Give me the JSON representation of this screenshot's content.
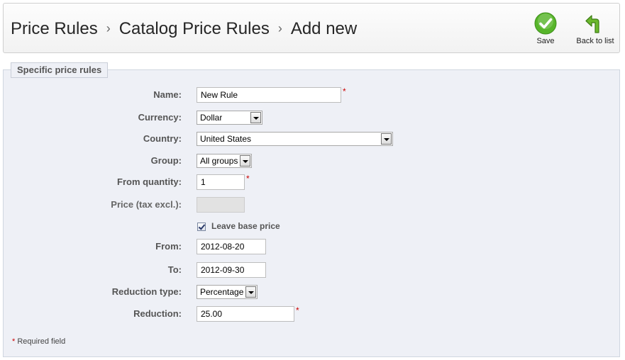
{
  "breadcrumb": [
    "Price Rules",
    "Catalog Price Rules",
    "Add new"
  ],
  "breadcrumb_separator": "›",
  "toolbar": {
    "save_label": "Save",
    "back_label": "Back to list"
  },
  "panel": {
    "legend": "Specific price rules"
  },
  "form": {
    "name": {
      "label": "Name:",
      "value": "New Rule",
      "required": "*"
    },
    "currency": {
      "label": "Currency:",
      "value": "Dollar"
    },
    "country": {
      "label": "Country:",
      "value": "United States"
    },
    "group": {
      "label": "Group:",
      "value": "All groups"
    },
    "from_quantity": {
      "label": "From quantity:",
      "value": "1",
      "required": "*"
    },
    "price": {
      "label": "Price (tax excl.):",
      "value": ""
    },
    "leave_base_price": {
      "label": "Leave base price",
      "checked": true
    },
    "from": {
      "label": "From:",
      "value": "2012-08-20"
    },
    "to": {
      "label": "To:",
      "value": "2012-09-30"
    },
    "reduction_type": {
      "label": "Reduction type:",
      "value": "Percentage"
    },
    "reduction": {
      "label": "Reduction:",
      "value": "25.00",
      "required": "*"
    }
  },
  "footer": {
    "required_star": "*",
    "required_note": "Required field"
  },
  "colors": {
    "save_green": "#57b52a",
    "back_green": "#5aa021",
    "required_red": "#cc0000"
  }
}
